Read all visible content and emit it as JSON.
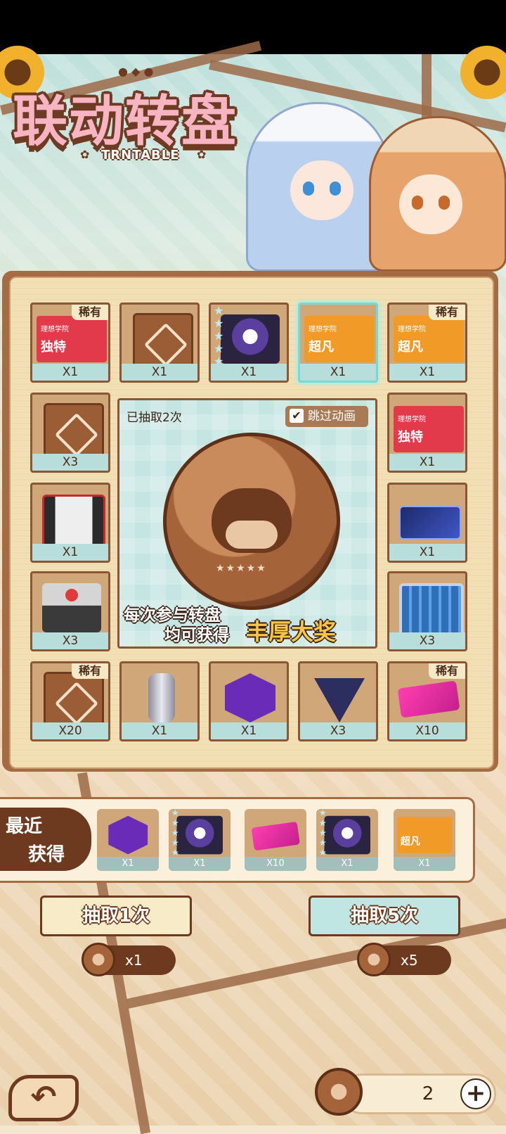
{
  "header": {
    "title": "联动转盘",
    "subtitle": "TRNTABLE"
  },
  "grid": [
    {
      "id": "c1",
      "type": "card",
      "card_tag": "独特",
      "card_school": "理想学院",
      "color": "#e2394b",
      "rare": "稀有",
      "qty": "X1"
    },
    {
      "id": "c2",
      "type": "fragment",
      "qty": "X1"
    },
    {
      "id": "c3",
      "type": "character",
      "qty": "X1"
    },
    {
      "id": "c4",
      "type": "card",
      "card_tag": "超凡",
      "card_school": "理想学院",
      "color": "#f19a28",
      "qty": "X1",
      "highlighted": true
    },
    {
      "id": "c5",
      "type": "card",
      "card_tag": "超凡",
      "card_school": "理想学院",
      "color": "#f19a28",
      "rare": "稀有",
      "qty": "X1"
    },
    {
      "id": "c6",
      "type": "fragment",
      "qty": "X3"
    },
    {
      "id": "c7",
      "type": "card",
      "card_tag": "独特",
      "card_school": "理想学院",
      "color": "#e2394b",
      "qty": "X1"
    },
    {
      "id": "c8",
      "type": "crate-red",
      "qty": "X1"
    },
    {
      "id": "c9",
      "type": "blue-card",
      "qty": "X1"
    },
    {
      "id": "c10",
      "type": "crate-grey",
      "qty": "X3"
    },
    {
      "id": "c11",
      "type": "case",
      "qty": "X3"
    },
    {
      "id": "c12",
      "type": "fragment",
      "rare": "稀有",
      "qty": "X20"
    },
    {
      "id": "c13",
      "type": "canister",
      "qty": "X1"
    },
    {
      "id": "c14",
      "type": "hex-badge",
      "qty": "X1"
    },
    {
      "id": "c15",
      "type": "tri-badge",
      "qty": "X3"
    },
    {
      "id": "c16",
      "type": "pink-card",
      "rare": "稀有",
      "qty": "X10"
    }
  ],
  "center": {
    "drawn_text": "已抽取2次",
    "skip_label": "跳过动画",
    "skip_checked": true,
    "promo_line1": "每次参与转盘",
    "promo_line2": "均可获得",
    "promo_highlight": "丰厚大奖"
  },
  "recent": {
    "label_line1": "最近",
    "label_line2": "获得",
    "items": [
      {
        "type": "hex-badge",
        "qty": "X1"
      },
      {
        "type": "character",
        "qty": "X1"
      },
      {
        "type": "pink-card",
        "qty": "X10"
      },
      {
        "type": "character",
        "qty": "X1"
      },
      {
        "type": "card",
        "card_tag": "超凡",
        "qty": "X1"
      }
    ]
  },
  "actions": {
    "draw1_label": "抽取1次",
    "draw1_cost": "x1",
    "draw5_label": "抽取5次",
    "draw5_cost": "x5"
  },
  "footer": {
    "balance": "2",
    "plus": "+",
    "back_icon": "back-arrow-icon"
  },
  "colors": {
    "brown": "#6d3a1f",
    "teal": "#b7dedb",
    "gold": "#f7c646"
  }
}
